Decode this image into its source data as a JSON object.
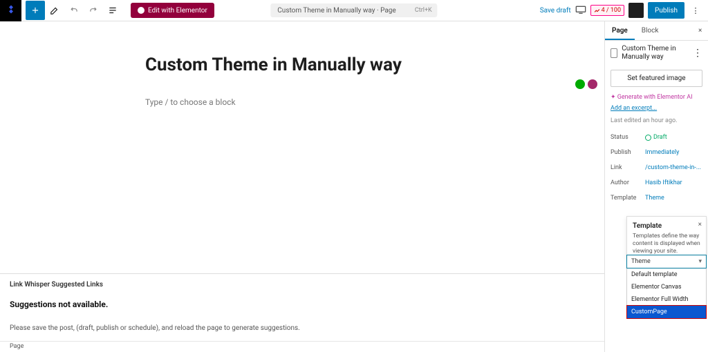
{
  "topbar": {
    "elementor_btn": "Edit with Elementor",
    "doc_title": "Custom Theme in Manually way · Page",
    "shortcut": "Ctrl+K",
    "save_draft": "Save draft",
    "score": "4 / 100",
    "publish": "Publish"
  },
  "editor": {
    "title": "Custom Theme in Manually way",
    "placeholder": "Type / to choose a block",
    "link_whisper": {
      "header": "Link Whisper Suggested Links",
      "not_avail": "Suggestions not available.",
      "note": "Please save the post, (draft, publish or schedule), and reload the page to generate suggestions."
    },
    "footer": "Page"
  },
  "sidebar": {
    "tabs": {
      "page": "Page",
      "block": "Block"
    },
    "doc_name": "Custom Theme in Manually way",
    "featured": "Set featured image",
    "ai": "✦ Generate with Elementor AI",
    "excerpt": "Add an excerpt...",
    "last_edit": "Last edited an hour ago.",
    "meta": {
      "status_k": "Status",
      "status_v": "Draft",
      "publish_k": "Publish",
      "publish_v": "Immediately",
      "link_k": "Link",
      "link_v": "/custom-theme-in-...",
      "author_k": "Author",
      "author_v": "Hasib Iftikhar",
      "template_k": "Template",
      "template_v": "Theme"
    }
  },
  "popover": {
    "title": "Template",
    "desc": "Templates define the way content is displayed when viewing your site.",
    "current": "Theme",
    "options": [
      "Default template",
      "Elementor Canvas",
      "Elementor Full Width",
      "CustomPage"
    ]
  }
}
